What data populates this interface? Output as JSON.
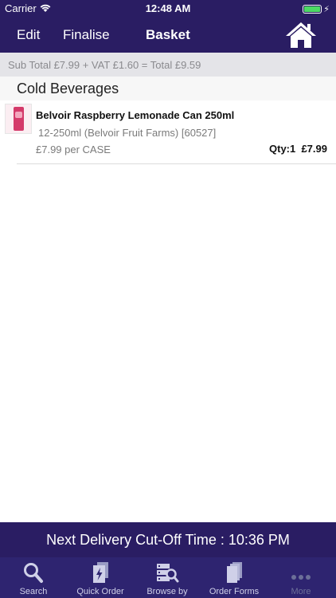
{
  "status_bar": {
    "carrier": "Carrier",
    "time": "12:48 AM"
  },
  "nav": {
    "edit": "Edit",
    "finalise": "Finalise",
    "title": "Basket"
  },
  "totals": {
    "summary": "Sub Total £7.99 + VAT £1.60 = Total £9.59"
  },
  "sections": [
    {
      "title": "Cold Beverages",
      "items": [
        {
          "name": "Belvoir Raspberry Lemonade Can 250ml",
          "pack": "12-250ml (Belvoir Fruit Farms) [60527]",
          "unit_price": "£7.99 per CASE",
          "qty_price": "Qty:1  £7.99"
        }
      ]
    }
  ],
  "cutoff": {
    "text": "Next Delivery Cut-Off Time : 10:36 PM"
  },
  "tabs": [
    {
      "label": "Search",
      "icon": "search-icon"
    },
    {
      "label": "Quick Order",
      "icon": "quick-order-icon"
    },
    {
      "label": "Browse by",
      "icon": "browse-icon"
    },
    {
      "label": "Order Forms",
      "icon": "order-forms-icon"
    },
    {
      "label": "More",
      "icon": "more-icon"
    }
  ],
  "colors": {
    "primary": "#2a1d63",
    "tab_bar": "#2e2470",
    "battery": "#4cd964"
  }
}
